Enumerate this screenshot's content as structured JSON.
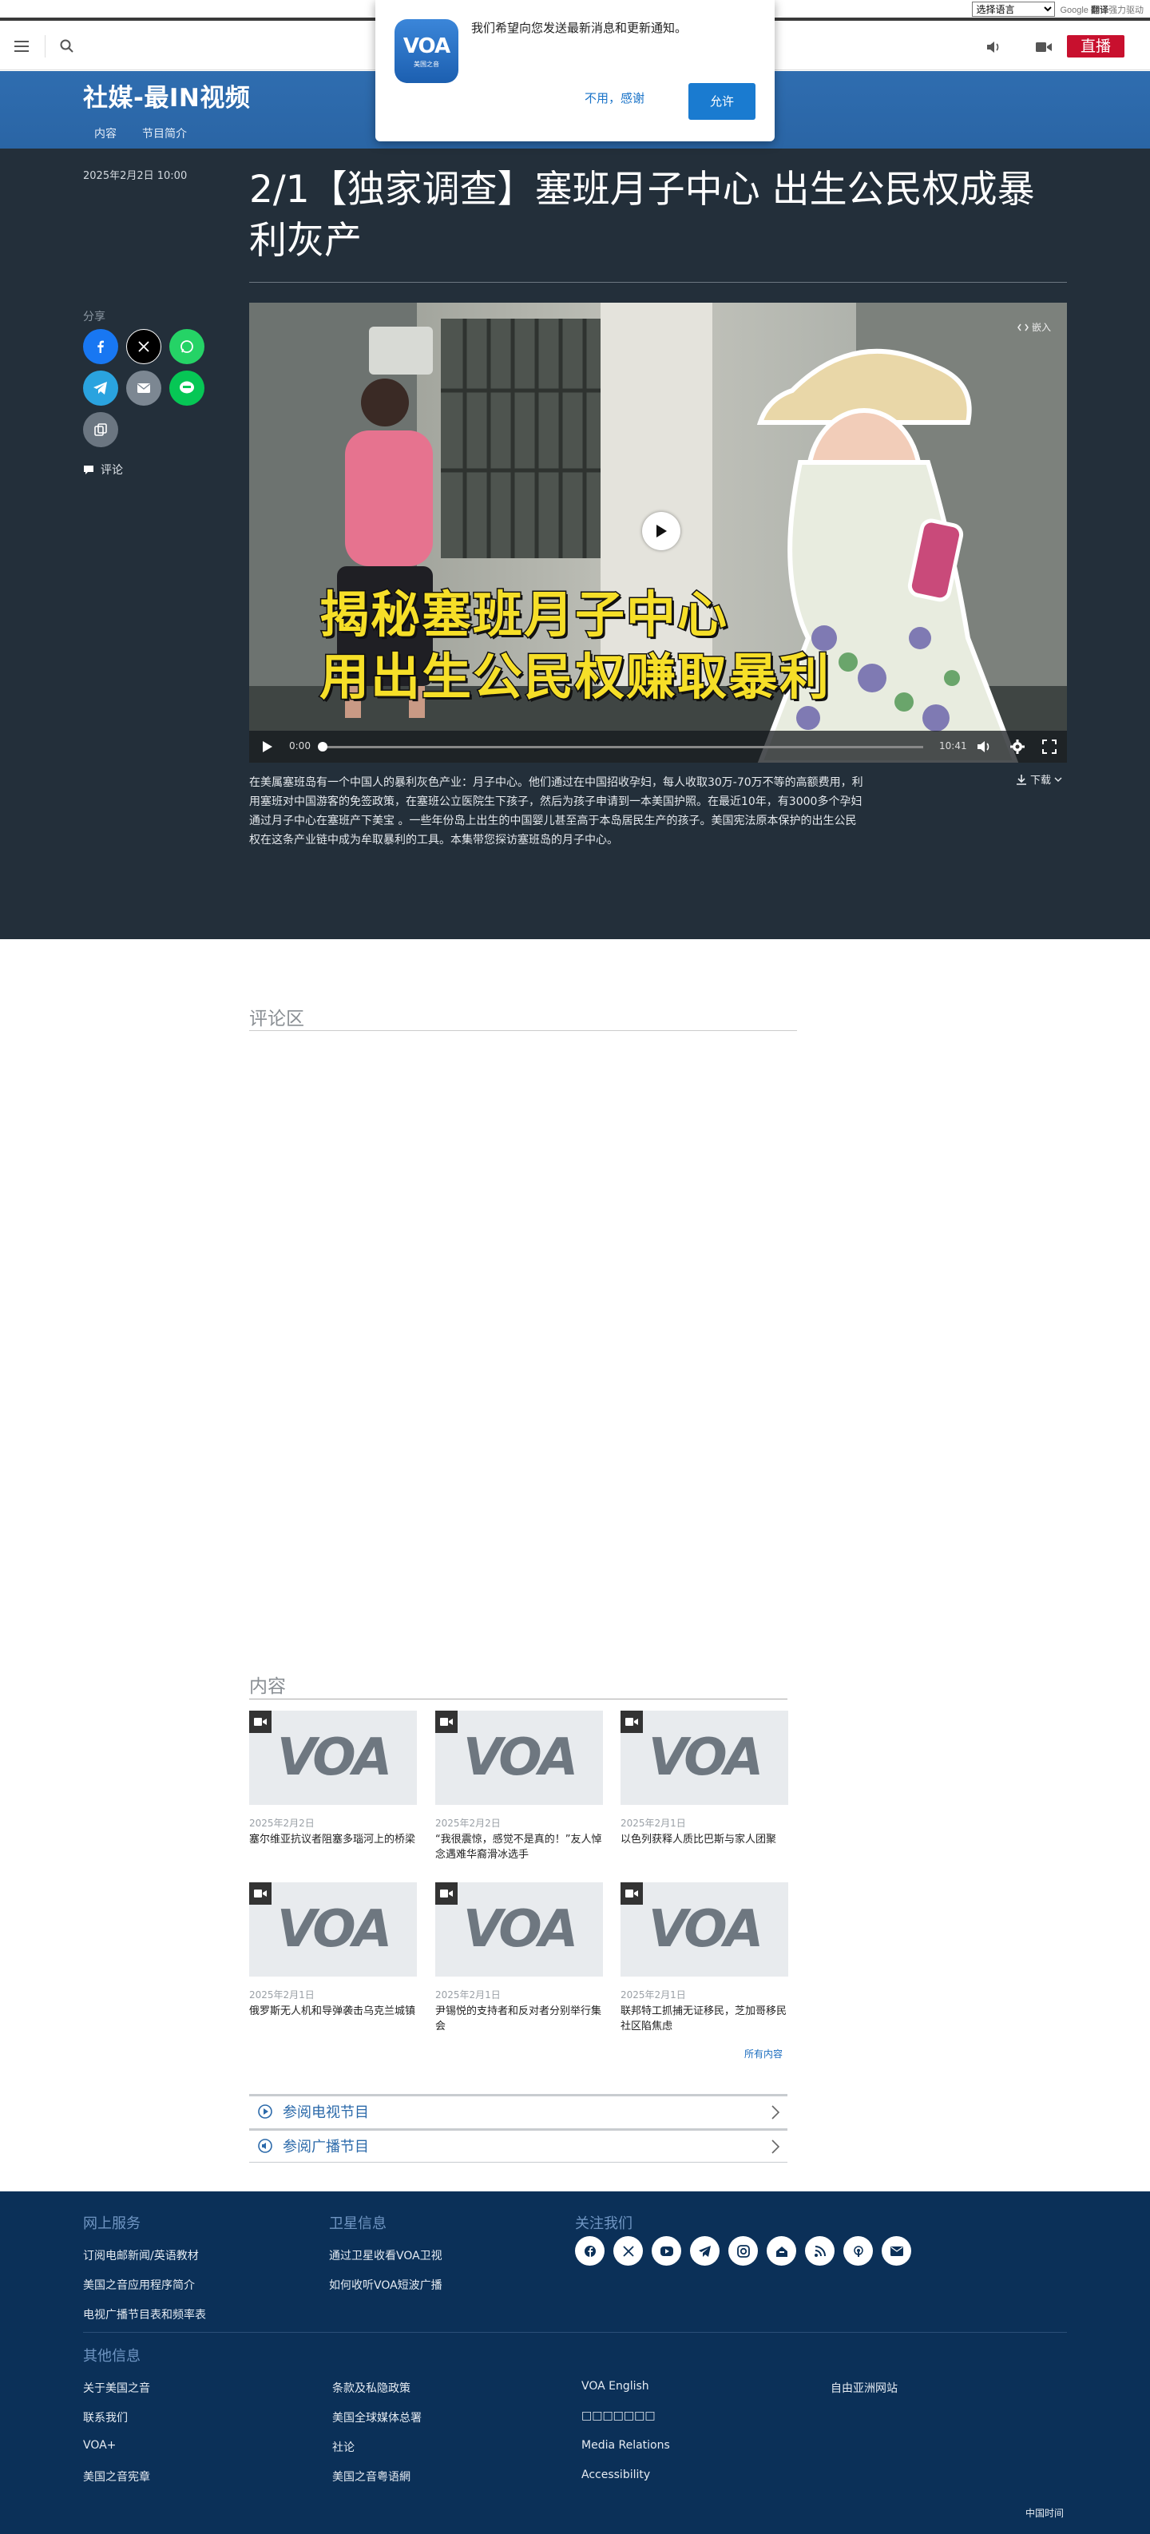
{
  "translate": {
    "select_value": "选择语言",
    "powered_label": "翻译",
    "powered_by": "Google",
    "powered_suffix": "强力驱动"
  },
  "header": {
    "live_label": "直播"
  },
  "section": {
    "title": "社媒-最IN视频",
    "nav": [
      "内容",
      "节目简介"
    ]
  },
  "notification": {
    "logo_text": "VOA",
    "logo_sub": "美国之音",
    "message": "我们希望向您发送最新消息和更新通知。",
    "decline": "不用，感谢",
    "accept": "允许"
  },
  "article": {
    "date": "2025年2月2日 10:00",
    "title": "2/1【独家调查】塞班月子中心 出生公民权成暴利灰产",
    "share_label": "分享",
    "comment_link": "评论",
    "video": {
      "caption_line1": "揭秘塞班月子中心",
      "caption_line2": "用出生公民权赚取暴利",
      "embed_label": "嵌入",
      "current_time": "0:00",
      "duration": "10:41",
      "progress": 0
    },
    "download_label": "下载",
    "summary": "在美属塞班岛有一个中国人的暴利灰色产业：月子中心。他们通过在中国招收孕妇，每人收取30万-70万不等的高额费用，利用塞班对中国游客的免签政策，在塞班公立医院生下孩子，然后为孩子申请到一本美国护照。在最近10年，有3000多个孕妇通过月子中心在塞班产下美宝 。一些年份岛上出生的中国婴儿甚至高于本岛居民生产的孩子。美国宪法原本保护的出生公民权在这条产业链中成为牟取暴利的工具。本集带您探访塞班岛的月子中心。"
  },
  "comments": {
    "title": "评论区"
  },
  "content": {
    "title": "内容",
    "items": [
      {
        "date": "2025年2月2日",
        "title": "塞尔维亚抗议者阻塞多瑙河上的桥梁"
      },
      {
        "date": "2025年2月2日",
        "title": "“我很震惊，感觉不是真的！”友人悼念遇难华裔滑冰选手"
      },
      {
        "date": "2025年2月1日",
        "title": "以色列获释人质比巴斯与家人团聚"
      },
      {
        "date": "2025年2月1日",
        "title": "俄罗斯无人机和导弹袭击乌克兰城镇"
      },
      {
        "date": "2025年2月1日",
        "title": "尹锡悦的支持者和反对者分别举行集会"
      },
      {
        "date": "2025年2月1日",
        "title": "联邦特工抓捕无证移民，芝加哥移民社区陷焦虑"
      }
    ],
    "thumb_logo": "VOA",
    "all_content": "所有内容",
    "tv_schedule": "参阅电视节目",
    "radio_schedule": "参阅广播节目"
  },
  "footer": {
    "online_title": "网上服务",
    "online_links": [
      "订阅电邮新闻/英语教材",
      "美国之音应用程序简介",
      "电视广播节目表和频率表"
    ],
    "satellite_title": "卫星信息",
    "satellite_links": [
      "通过卫星收看VOA卫视",
      "如何收听VOA短波广播"
    ],
    "follow_title": "关注我们",
    "social_icons": [
      "facebook-icon",
      "x-icon",
      "youtube-icon",
      "telegram-icon",
      "instagram-icon",
      "podcast-icon",
      "rss-icon",
      "podcast-broadcast-icon",
      "email-icon"
    ],
    "other_title": "其他信息",
    "other_col1": [
      "关于美国之音",
      "联系我们",
      "VOA+",
      "美国之音宪章"
    ],
    "other_col2": [
      "条款及私隐政策",
      "美国全球媒体总署",
      "社论",
      "美国之音粤语網"
    ],
    "other_col3": [
      "VOA English",
      "□□□□□□□",
      "Media Relations",
      "Accessibility"
    ],
    "other_col4": [
      "自由亚洲网站"
    ],
    "timezone": "中国时间"
  },
  "colors": {
    "brand_blue": "#2c6aaa",
    "live_red": "#c8102e",
    "article_bg": "#232f3a",
    "footer_bg": "#0b3058",
    "caption_yellow": "#f6df28"
  }
}
